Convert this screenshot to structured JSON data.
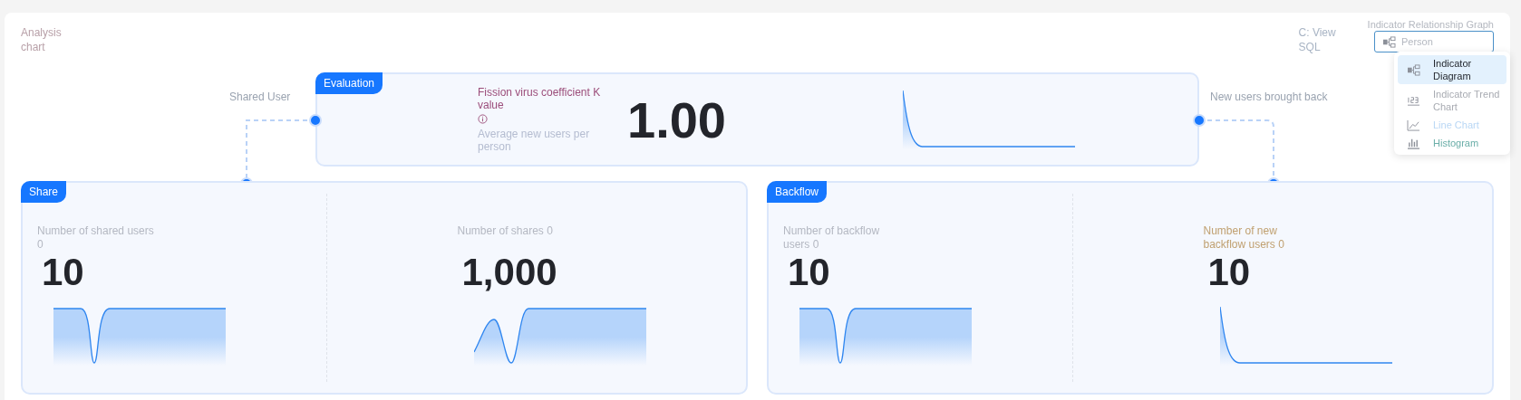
{
  "header": {
    "title": "Analysis chart",
    "view_sql": "C: View SQL",
    "select": {
      "label": "Indicator Relationship Graph",
      "placeholder": "Person"
    }
  },
  "menu": [
    {
      "label": "Indicator Diagram",
      "kind": "diagram",
      "selected": true,
      "color": "#1f2329"
    },
    {
      "label": "Indicator Trend Chart",
      "kind": "numbers",
      "selected": false,
      "color": "#a8abb2"
    },
    {
      "label": "Line Chart",
      "kind": "line",
      "selected": false,
      "color": "#b9d7f5"
    },
    {
      "label": "Histogram",
      "kind": "bars",
      "selected": false,
      "color": "#6aaea8"
    }
  ],
  "evaluation": {
    "tag": "Evaluation",
    "left_link": "Shared User",
    "right_link": "New users brought back",
    "metric": {
      "label": "Fission virus coefficient K value",
      "color": "#9b4d7a",
      "sublabel": "Average new users per person",
      "value": "1.00",
      "kind": "decay"
    }
  },
  "groups": [
    {
      "tag": "Share",
      "metrics": [
        {
          "label": "Number of shared users 0",
          "color": "#b4b8c2",
          "value": "10",
          "kind": "dip"
        },
        {
          "label": "Number of shares 0",
          "color": "#b4b8c2",
          "value": "1,000",
          "kind": "bump"
        }
      ]
    },
    {
      "tag": "Backflow",
      "metrics": [
        {
          "label": "Number of backflow users 0",
          "color": "#b4b8c2",
          "value": "10",
          "kind": "dip"
        },
        {
          "label": "Number of new backflow users 0",
          "color": "#c0a070",
          "value": "10",
          "kind": "decay"
        }
      ]
    }
  ]
}
